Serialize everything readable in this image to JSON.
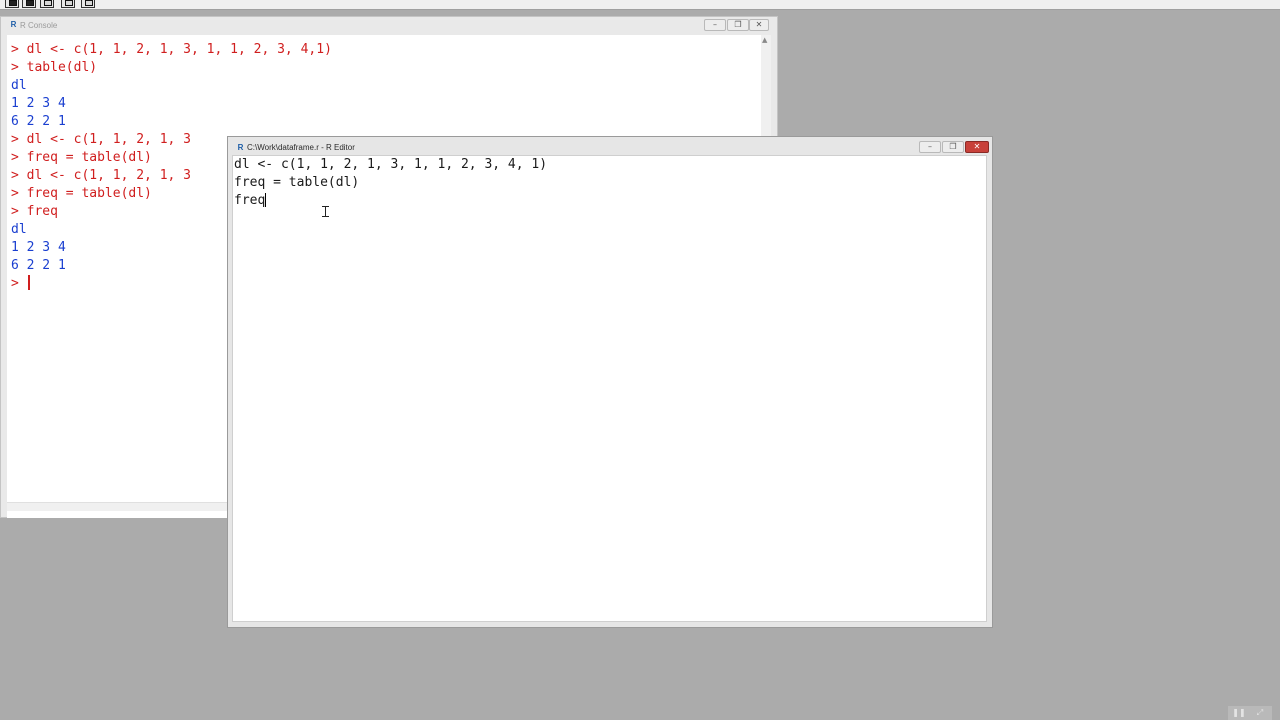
{
  "toolbar": {
    "buttons": [
      {
        "icon": "open-script-icon"
      },
      {
        "icon": "load-workspace-icon"
      },
      {
        "icon": "save-workspace-icon"
      },
      {
        "icon": "copy-icon"
      },
      {
        "icon": "print-icon"
      }
    ]
  },
  "console": {
    "title": "R Console",
    "lines": [
      {
        "text": "> dl <- c(1, 1, 2, 1, 3, 1, 1, 2, 3, 4,1)",
        "kind": "input"
      },
      {
        "text": "> table(dl)",
        "kind": "input"
      },
      {
        "text": "dl",
        "kind": "output"
      },
      {
        "text": "1 2 3 4",
        "kind": "output"
      },
      {
        "text": "6 2 2 1",
        "kind": "output"
      },
      {
        "text": "> dl <- c(1, 1, 2, 1, 3",
        "kind": "input"
      },
      {
        "text": "> freq = table(dl)",
        "kind": "input"
      },
      {
        "text": "> dl <- c(1, 1, 2, 1, 3",
        "kind": "input"
      },
      {
        "text": "> freq = table(dl)",
        "kind": "input"
      },
      {
        "text": "> freq",
        "kind": "input"
      },
      {
        "text": "dl",
        "kind": "output"
      },
      {
        "text": "1 2 3 4",
        "kind": "output"
      },
      {
        "text": "6 2 2 1",
        "kind": "output"
      }
    ],
    "prompt": "> "
  },
  "editor": {
    "title": "C:\\Work\\dataframe.r - R Editor",
    "lines": [
      "dl <- c(1, 1, 2, 1, 3, 1, 1, 2, 3, 4, 1)",
      "freq = table(dl)",
      "freq"
    ]
  },
  "window_controls": {
    "minimize": "–",
    "restore": "❐",
    "close": "✕"
  },
  "overlay": {
    "pause": "❚❚",
    "fullscreen": "⤢"
  },
  "colors": {
    "console_input": "#d01e1e",
    "console_output": "#1a3fd0",
    "desktop": "#ababab",
    "close_button": "#c8413a"
  }
}
